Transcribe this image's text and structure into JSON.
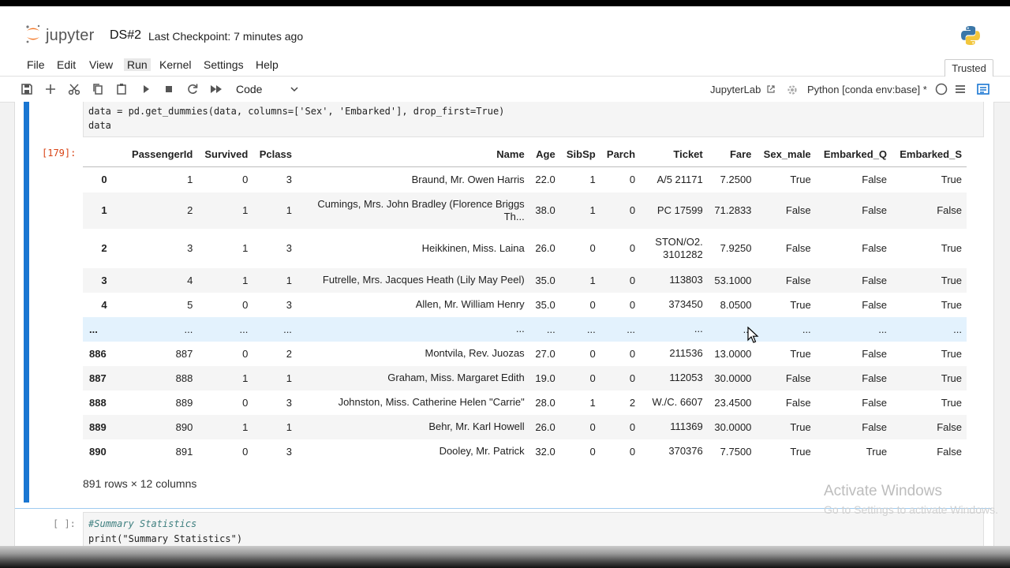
{
  "header": {
    "brand": "jupyter",
    "notebook_title": "DS#2",
    "checkpoint": "Last Checkpoint: 7 minutes ago",
    "logo_colors": {
      "orange": "#f37726",
      "grey": "#767677"
    },
    "kernel_logo_icon": "python-logo-icon"
  },
  "menu": {
    "items": [
      "File",
      "Edit",
      "View",
      "Run",
      "Kernel",
      "Settings",
      "Help"
    ],
    "active": "Run",
    "trusted": "Trusted"
  },
  "toolbar": {
    "icons": [
      "save-icon",
      "add-cell-icon",
      "cut-icon",
      "copy-icon",
      "paste-icon",
      "run-icon",
      "stop-icon",
      "restart-icon",
      "fast-forward-icon"
    ],
    "cell_type": "Code",
    "jupyterlab_link": "JupyterLab",
    "kernel_name": "Python [conda env:base] *",
    "accent_color": "#1976d2"
  },
  "cell": {
    "code_lines": [
      "data = pd.get_dummies(data, columns=['Sex', 'Embarked'], drop_first=True)",
      "data"
    ],
    "output_prompt": "[179]:",
    "table": {
      "columns": [
        "",
        "PassengerId",
        "Survived",
        "Pclass",
        "Name",
        "Age",
        "SibSp",
        "Parch",
        "Ticket",
        "Fare",
        "Sex_male",
        "Embarked_Q",
        "Embarked_S"
      ],
      "rows": [
        [
          "0",
          "1",
          "0",
          "3",
          "Braund, Mr. Owen Harris",
          "22.0",
          "1",
          "0",
          "A/5 21171",
          "7.2500",
          "True",
          "False",
          "True"
        ],
        [
          "1",
          "2",
          "1",
          "1",
          "Cumings, Mrs. John Bradley (Florence Briggs Th...",
          "38.0",
          "1",
          "0",
          "PC 17599",
          "71.2833",
          "False",
          "False",
          "False"
        ],
        [
          "2",
          "3",
          "1",
          "3",
          "Heikkinen, Miss. Laina",
          "26.0",
          "0",
          "0",
          "STON/O2. 3101282",
          "7.9250",
          "False",
          "False",
          "True"
        ],
        [
          "3",
          "4",
          "1",
          "1",
          "Futrelle, Mrs. Jacques Heath (Lily May Peel)",
          "35.0",
          "1",
          "0",
          "113803",
          "53.1000",
          "False",
          "False",
          "True"
        ],
        [
          "4",
          "5",
          "0",
          "3",
          "Allen, Mr. William Henry",
          "35.0",
          "0",
          "0",
          "373450",
          "8.0500",
          "True",
          "False",
          "True"
        ],
        [
          "...",
          "...",
          "...",
          "...",
          "...",
          "...",
          "...",
          "...",
          "...",
          "...",
          "...",
          "...",
          "..."
        ],
        [
          "886",
          "887",
          "0",
          "2",
          "Montvila, Rev. Juozas",
          "27.0",
          "0",
          "0",
          "211536",
          "13.0000",
          "True",
          "False",
          "True"
        ],
        [
          "887",
          "888",
          "1",
          "1",
          "Graham, Miss. Margaret Edith",
          "19.0",
          "0",
          "0",
          "112053",
          "30.0000",
          "False",
          "False",
          "True"
        ],
        [
          "888",
          "889",
          "0",
          "3",
          "Johnston, Miss. Catherine Helen \"Carrie\"",
          "28.0",
          "1",
          "2",
          "W./C. 6607",
          "23.4500",
          "False",
          "False",
          "True"
        ],
        [
          "889",
          "890",
          "1",
          "1",
          "Behr, Mr. Karl Howell",
          "26.0",
          "0",
          "0",
          "111369",
          "30.0000",
          "True",
          "False",
          "False"
        ],
        [
          "890",
          "891",
          "0",
          "3",
          "Dooley, Mr. Patrick",
          "32.0",
          "0",
          "0",
          "370376",
          "7.7500",
          "True",
          "True",
          "False"
        ]
      ]
    },
    "shape_text": "891 rows × 12 columns"
  },
  "next_cell": {
    "prompt": "[ ]:",
    "code_lines": [
      "#Summary Statistics",
      "print(\"Summary Statistics\")"
    ]
  },
  "watermark": {
    "title": "Activate Windows",
    "subtitle": "Go to Settings to activate Windows."
  }
}
